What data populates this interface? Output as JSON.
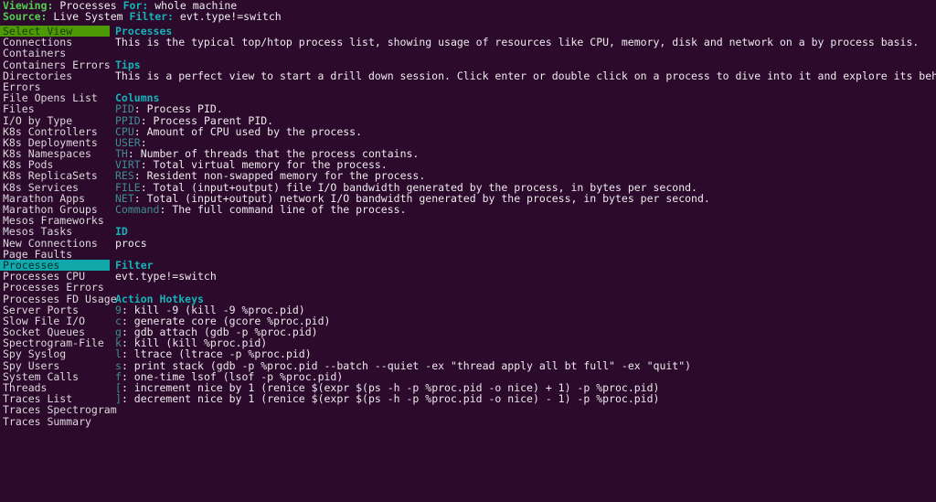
{
  "header": {
    "viewing_label": "Viewing:",
    "viewing_value": "Processes",
    "for_label": "For:",
    "for_value": "whole machine",
    "source_label": "Source:",
    "source_value": "Live System",
    "filter_label": "Filter:",
    "filter_value": "evt.type!=switch"
  },
  "sidebar": {
    "title": "Select View",
    "selected": "Processes",
    "items": [
      "Connections",
      "Containers",
      "Containers Errors",
      "Directories",
      "Errors",
      "File Opens List",
      "Files",
      "I/O by Type",
      "K8s Controllers",
      "K8s Deployments",
      "K8s Namespaces",
      "K8s Pods",
      "K8s ReplicaSets",
      "K8s Services",
      "Marathon Apps",
      "Marathon Groups",
      "Mesos Frameworks",
      "Mesos Tasks",
      "New Connections",
      "Page Faults",
      "Processes",
      "Processes CPU",
      "Processes Errors",
      "Processes FD Usage",
      "Server Ports",
      "Slow File I/O",
      "Socket Queues",
      "Spectrogram-File",
      "Spy Syslog",
      "Spy Users",
      "System Calls",
      "Threads",
      "Traces List",
      "Traces Spectrogram",
      "Traces Summary"
    ]
  },
  "main": {
    "title": "Processes",
    "description": "This is the typical top/htop process list, showing usage of resources like CPU, memory, disk and network on a by process basis.",
    "tips_heading": "Tips",
    "tips_text": "This is a perfect view to start a drill down session. Click enter or double click on a process to dive into it and explore its behavior.",
    "columns_heading": "Columns",
    "columns": [
      {
        "name": "PID",
        "desc": ": Process PID."
      },
      {
        "name": "PPID",
        "desc": ": Process Parent PID."
      },
      {
        "name": "CPU",
        "desc": ": Amount of CPU used by the process."
      },
      {
        "name": "USER",
        "desc": ":"
      },
      {
        "name": "TH",
        "desc": ": Number of threads that the process contains."
      },
      {
        "name": "VIRT",
        "desc": ": Total virtual memory for the process."
      },
      {
        "name": "RES",
        "desc": ": Resident non-swapped memory for the process."
      },
      {
        "name": "FILE",
        "desc": ": Total (input+output) file I/O bandwidth generated by the process, in bytes per second."
      },
      {
        "name": "NET",
        "desc": ": Total (input+output) network I/O bandwidth generated by the process, in bytes per second."
      },
      {
        "name": "Command",
        "desc": ": The full command line of the process."
      }
    ],
    "id_heading": "ID",
    "id_value": "procs",
    "filter_heading": "Filter",
    "filter_value": "evt.type!=switch",
    "hotkeys_heading": "Action Hotkeys",
    "hotkeys": [
      {
        "key": "9",
        "desc": ": kill -9 (kill -9 %proc.pid)"
      },
      {
        "key": "c",
        "desc": ": generate core (gcore %proc.pid)"
      },
      {
        "key": "g",
        "desc": ": gdb attach (gdb -p %proc.pid)"
      },
      {
        "key": "k",
        "desc": ": kill (kill %proc.pid)"
      },
      {
        "key": "l",
        "desc": ": ltrace (ltrace -p %proc.pid)"
      },
      {
        "key": "s",
        "desc": ": print stack (gdb -p %proc.pid --batch --quiet -ex \"thread apply all bt full\" -ex \"quit\")"
      },
      {
        "key": "f",
        "desc": ": one-time lsof (lsof -p %proc.pid)"
      },
      {
        "key": "[",
        "desc": ": increment nice by 1 (renice $(expr $(ps -h -p %proc.pid -o nice) + 1) -p %proc.pid)"
      },
      {
        "key": "]",
        "desc": ": decrement nice by 1 (renice $(expr $(ps -h -p %proc.pid -o nice) - 1) -p %proc.pid)"
      }
    ]
  },
  "colors": {
    "background": "#2b0a2b",
    "green_bar": "#4e9a06",
    "selection_cyan": "#11a8ab",
    "heading_teal": "#17b3b8",
    "dim_teal": "#3f8d92",
    "text_white": "#efeaef"
  }
}
